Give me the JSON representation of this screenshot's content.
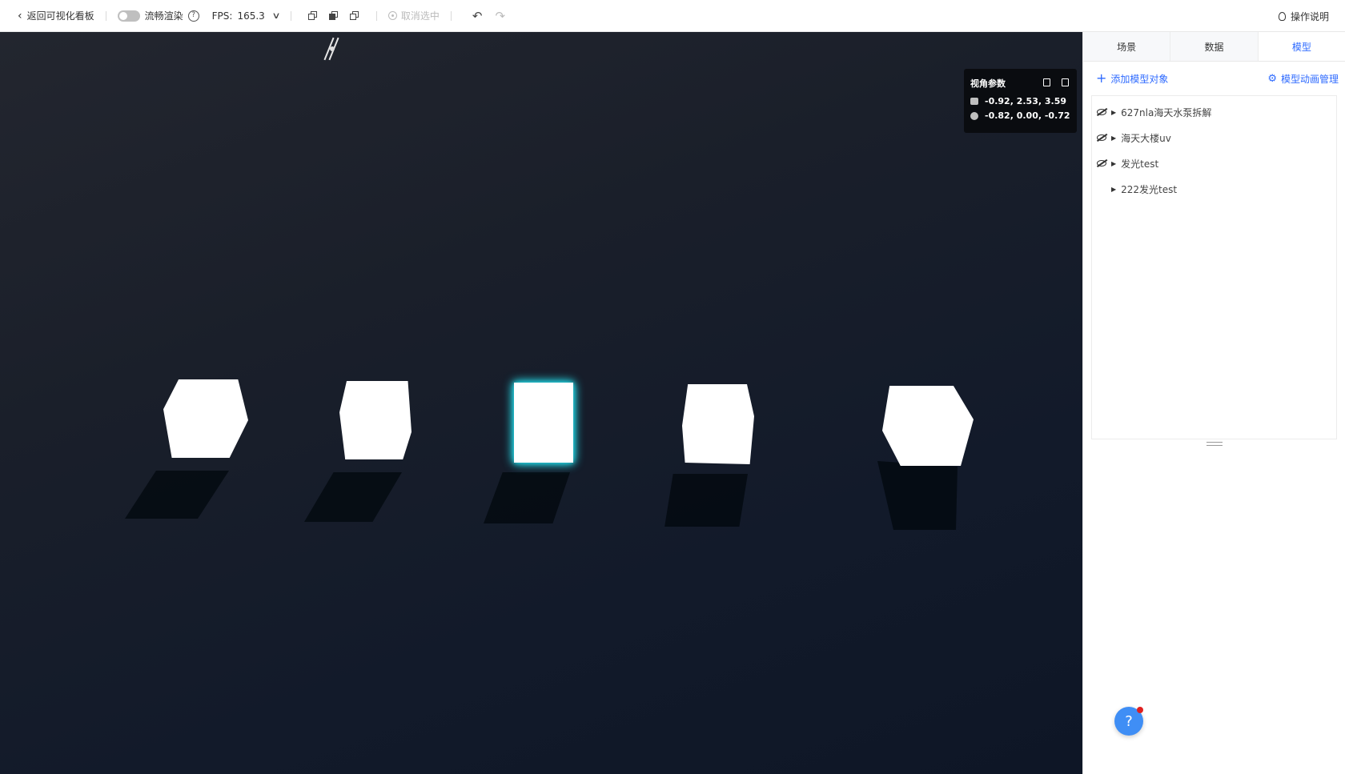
{
  "toolbar": {
    "back_label": "返回可视化看板",
    "smooth_render_label": "流畅渲染",
    "smooth_render_on": false,
    "fps_label": "FPS:",
    "fps_value": "165.3",
    "deselect_label": "取消选中",
    "guide_label": "操作说明"
  },
  "viewport": {
    "camera_panel": {
      "title": "视角参数",
      "position": "-0.92, 2.53, 3.59",
      "target": "-0.82, 0.00, -0.72"
    },
    "glow_colors": [
      "#2f7dff",
      "#2f7dff",
      "#19c9d9",
      "#19c9d9",
      "#19c9d9"
    ]
  },
  "panel": {
    "tabs": [
      "场景",
      "数据",
      "模型"
    ],
    "active_tab": "模型",
    "add_label": "添加模型对象",
    "anim_label": "模型动画管理",
    "tree": [
      {
        "label": "627nla海天水泵拆解",
        "hidden": true
      },
      {
        "label": "海天大楼uv",
        "hidden": true
      },
      {
        "label": "发光test",
        "hidden": true
      },
      {
        "label": "222发光test",
        "hidden": false
      }
    ]
  },
  "colors": {
    "accent": "#2f6bff",
    "help_fab": "#3f8ef5",
    "badge": "#e02020"
  }
}
